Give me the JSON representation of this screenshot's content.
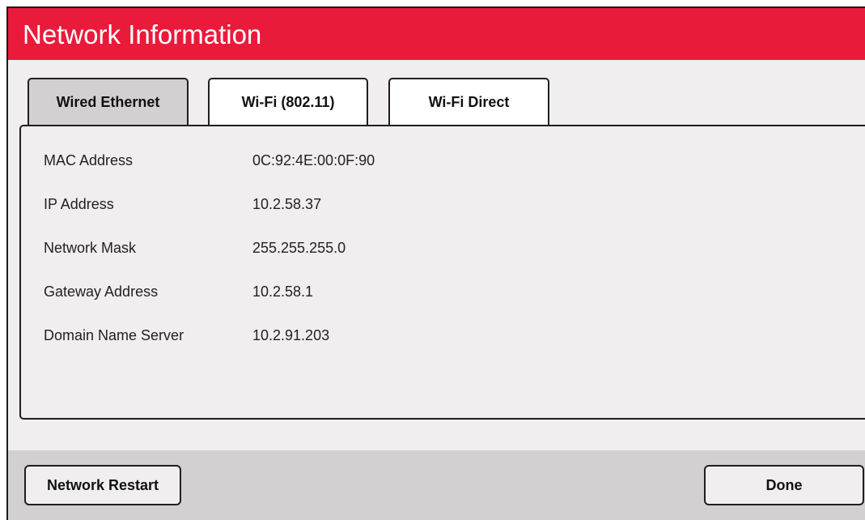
{
  "header": {
    "title": "Network Information"
  },
  "tabs": [
    {
      "label": "Wired Ethernet",
      "active": true
    },
    {
      "label": "Wi-Fi (802.11)",
      "active": false
    },
    {
      "label": "Wi-Fi Direct",
      "active": false
    }
  ],
  "info": [
    {
      "label": "MAC Address",
      "value": "0C:92:4E:00:0F:90"
    },
    {
      "label": "IP Address",
      "value": "10.2.58.37"
    },
    {
      "label": "Network Mask",
      "value": "255.255.255.0"
    },
    {
      "label": "Gateway Address",
      "value": "10.2.58.1"
    },
    {
      "label": "Domain Name Server",
      "value": "10.2.91.203"
    }
  ],
  "buttons": {
    "restart": "Network Restart",
    "done": "Done"
  },
  "colors": {
    "title_bar": "#ea1a3b",
    "background": "#f0eeee",
    "active_tab": "#d2d0d0",
    "button_bar": "#d2d0d0"
  }
}
